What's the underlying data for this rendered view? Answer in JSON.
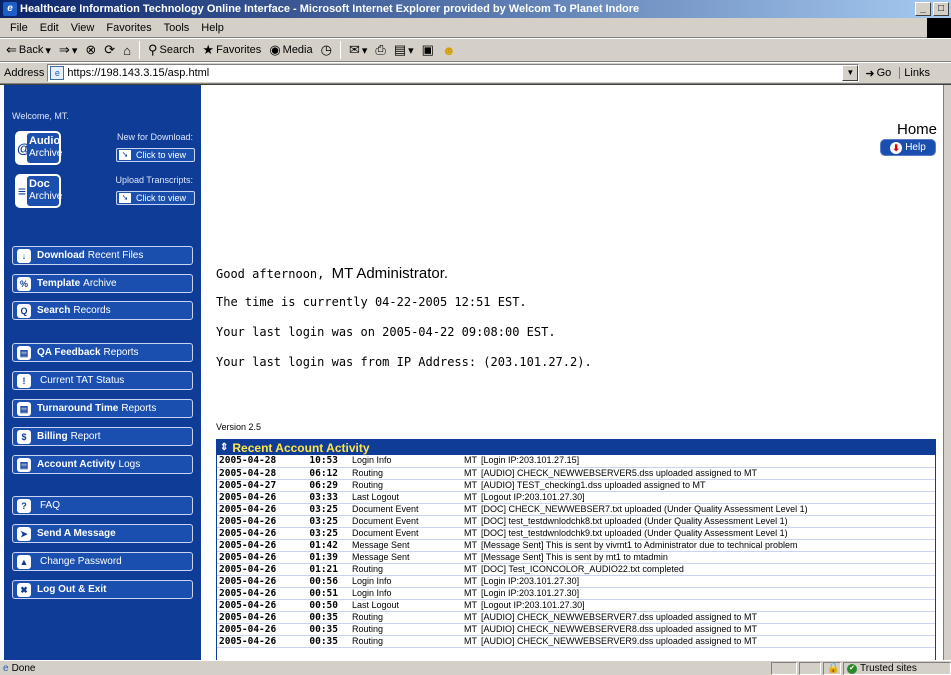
{
  "window": {
    "title": "Healthcare Information Technology Online Interface - Microsoft Internet Explorer provided by Welcom To Planet Indore",
    "min_label": "_",
    "max_label": "□"
  },
  "menu": [
    "File",
    "Edit",
    "View",
    "Favorites",
    "Tools",
    "Help"
  ],
  "toolbar": {
    "back": "Back",
    "search": "Search",
    "favorites": "Favorites",
    "media": "Media"
  },
  "address": {
    "label": "Address",
    "url": "https://198.143.3.15/asp.html",
    "go": "Go",
    "links": "Links"
  },
  "sidebar": {
    "welcome": "Welcome, MT.",
    "audio": {
      "line1": "Audio",
      "line2": "Archive",
      "download_label": "New for Download:",
      "button": "Click to view"
    },
    "doc": {
      "line1": "Doc",
      "line2": "Archive",
      "upload_label": "Upload Transcripts:",
      "button": "Click to view"
    },
    "nav": [
      {
        "bold": "Download",
        "rest": "Recent Files"
      },
      {
        "bold": "Template",
        "rest": "Archive"
      },
      {
        "bold": "Search",
        "rest": "Records"
      },
      {
        "bold": "QA Feedback",
        "rest": "Reports"
      },
      {
        "bold": "",
        "rest": "Current TAT Status"
      },
      {
        "bold": "Turnaround Time",
        "rest": "Reports"
      },
      {
        "bold": "Billing",
        "rest": "Report"
      },
      {
        "bold": "Account Activity",
        "rest": "Logs"
      },
      {
        "bold": "",
        "rest": "FAQ"
      },
      {
        "bold": "Send A Message",
        "rest": ""
      },
      {
        "bold": "",
        "rest": "Change Password"
      },
      {
        "bold": "Log Out & Exit",
        "rest": ""
      }
    ]
  },
  "main": {
    "page_title": "Home",
    "help": "Help",
    "greeting_prefix": "Good afternoon,",
    "greeting_name": "MT Administrator.",
    "time_line": "The time is currently 04-22-2005 12:51 EST.",
    "last_login": "Your last login was on 2005-04-22 09:08:00 EST.",
    "last_ip": "Your last login was from IP Address: (203.101.27.2).",
    "version": "Version 2.5",
    "activity_title": "Recent Account Activity"
  },
  "activity_rows": [
    {
      "date": "2005-04-28",
      "time": "10:53",
      "event": "Login Info",
      "user": "MT",
      "detail": "[Login IP:203.101.27.15]"
    },
    {
      "date": "2005-04-28",
      "time": "06:12",
      "event": "Routing",
      "user": "MT",
      "detail": "[AUDIO] CHECK_NEWWEBSERVER5.dss uploaded assigned to MT"
    },
    {
      "date": "2005-04-27",
      "time": "06:29",
      "event": "Routing",
      "user": "MT",
      "detail": "[AUDIO] TEST_checking1.dss uploaded assigned to MT"
    },
    {
      "date": "2005-04-26",
      "time": "03:33",
      "event": "Last Logout",
      "user": "MT",
      "detail": "[Logout IP:203.101.27.30]"
    },
    {
      "date": "2005-04-26",
      "time": "03:25",
      "event": "Document Event",
      "user": "MT",
      "detail": "[DOC] CHECK_NEWWEBSER7.txt uploaded (Under Quality Assessment Level 1)"
    },
    {
      "date": "2005-04-26",
      "time": "03:25",
      "event": "Document Event",
      "user": "MT",
      "detail": "[DOC] test_testdwnlodchk8.txt uploaded (Under Quality Assessment Level 1)"
    },
    {
      "date": "2005-04-26",
      "time": "03:25",
      "event": "Document Event",
      "user": "MT",
      "detail": "[DOC] test_testdwnlodchk9.txt uploaded (Under Quality Assessment Level 1)"
    },
    {
      "date": "2005-04-26",
      "time": "01:42",
      "event": "Message Sent",
      "user": "MT",
      "detail": "[Message Sent] This is sent by vivmt1 to Administrator due to technical problem"
    },
    {
      "date": "2005-04-26",
      "time": "01:39",
      "event": "Message Sent",
      "user": "MT",
      "detail": "[Message Sent] This is sent by mt1 to mtadmin"
    },
    {
      "date": "2005-04-26",
      "time": "01:21",
      "event": "Routing",
      "user": "MT",
      "detail": "[DOC] Test_ICONCOLOR_AUDIO22.txt completed"
    },
    {
      "date": "2005-04-26",
      "time": "00:56",
      "event": "Login Info",
      "user": "MT",
      "detail": "[Login IP:203.101.27.30]"
    },
    {
      "date": "2005-04-26",
      "time": "00:51",
      "event": "Login Info",
      "user": "MT",
      "detail": "[Login IP:203.101.27.30]"
    },
    {
      "date": "2005-04-26",
      "time": "00:50",
      "event": "Last Logout",
      "user": "MT",
      "detail": "[Logout IP:203.101.27.30]"
    },
    {
      "date": "2005-04-26",
      "time": "00:35",
      "event": "Routing",
      "user": "MT",
      "detail": "[AUDIO] CHECK_NEWWEBSERVER7.dss uploaded assigned to MT"
    },
    {
      "date": "2005-04-26",
      "time": "00:35",
      "event": "Routing",
      "user": "MT",
      "detail": "[AUDIO] CHECK_NEWWEBSERVER8.dss uploaded assigned to MT"
    },
    {
      "date": "2005-04-26",
      "time": "00:35",
      "event": "Routing",
      "user": "MT",
      "detail": "[AUDIO] CHECK_NEWWEBSERVER9.dss uploaded assigned to MT"
    }
  ],
  "status": {
    "done": "Done",
    "zone": "Trusted sites"
  },
  "colors": {
    "sidebar": "#0f3c96",
    "button": "#1a4fb0",
    "activity_title": "#ffe74a"
  }
}
